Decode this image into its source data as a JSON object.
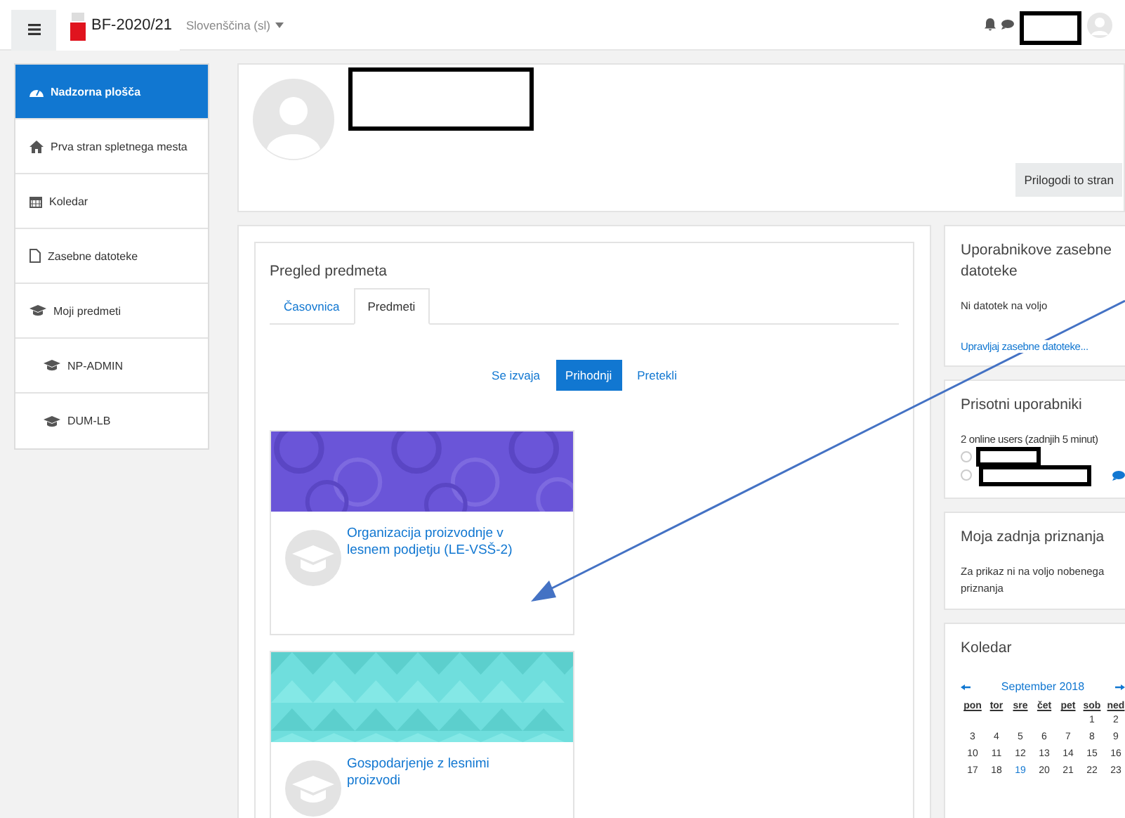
{
  "navbar": {
    "site_name": "BF-2020/21",
    "language": "Slovenščina (sl)"
  },
  "sidebar": {
    "items": [
      {
        "label": "Nadzorna plošča",
        "kind": "dashboard",
        "selected": true
      },
      {
        "label": "Prva stran spletnega mesta",
        "kind": "home",
        "selected": false
      },
      {
        "label": "Koledar",
        "kind": "calendar",
        "selected": false
      },
      {
        "label": "Zasebne datoteke",
        "kind": "file",
        "selected": false
      },
      {
        "label": "Moji predmeti",
        "kind": "course",
        "selected": false,
        "children": [
          {
            "label": "NP-ADMIN",
            "kind": "course",
            "selected": false
          },
          {
            "label": "DUM-LB",
            "kind": "course",
            "selected": false
          }
        ]
      }
    ]
  },
  "header": {
    "button": "Prilogodi to stran"
  },
  "course_overview": {
    "title": "Pregled predmeta",
    "tabs": [
      {
        "label": "Časovnica",
        "selected": false
      },
      {
        "label": "Predmeti",
        "selected": true
      }
    ],
    "filters": [
      {
        "label": "Se izvaja",
        "selected": false
      },
      {
        "label": "Prihodnji",
        "selected": true
      },
      {
        "label": "Pretekli",
        "selected": false
      }
    ],
    "courses": [
      {
        "name": "Organizacija proizvodnje v lesnem podjetju (LE-VSŠ-2)"
      },
      {
        "name": "Gospodarjenje z lesnimi proizvodi"
      }
    ]
  },
  "private_files": {
    "title": "Uporabnikove zasebne datoteke",
    "message": "Ni datotek na voljo",
    "link": "Upravljaj zasebne datoteke..."
  },
  "online_users": {
    "title": "Prisotni uporabniki",
    "summary": "2 online users (zadnjih 5 minut)",
    "users": [
      {
        "message_icon": false
      },
      {
        "message_icon": true
      }
    ]
  },
  "badges": {
    "title": "Moja zadnja priznanja",
    "message": "Za prikaz ni na voljo nobenega priznanja"
  },
  "calendar": {
    "title": "Koledar",
    "month": "September 2018",
    "weekdays": [
      "pon",
      "tor",
      "sre",
      "čet",
      "pet",
      "sob",
      "ned"
    ],
    "weeks": [
      {
        "days": [
          {
            "day": "1",
            "today": false
          },
          {
            "day": "2",
            "today": false
          }
        ]
      },
      {
        "days": [
          {
            "day": "3",
            "today": false
          },
          {
            "day": "4",
            "today": false
          },
          {
            "day": "5",
            "today": false
          },
          {
            "day": "6",
            "today": false
          },
          {
            "day": "7",
            "today": false
          },
          {
            "day": "8",
            "today": false
          },
          {
            "day": "9",
            "today": false
          }
        ]
      },
      {
        "days": [
          {
            "day": "10",
            "today": false
          },
          {
            "day": "11",
            "today": false
          },
          {
            "day": "12",
            "today": false
          },
          {
            "day": "13",
            "today": false
          },
          {
            "day": "14",
            "today": false
          },
          {
            "day": "15",
            "today": false
          },
          {
            "day": "16",
            "today": false
          }
        ]
      },
      {
        "days": [
          {
            "day": "17",
            "today": false
          },
          {
            "day": "18",
            "today": false
          },
          {
            "day": "19",
            "today": true
          },
          {
            "day": "20",
            "today": false
          },
          {
            "day": "21",
            "today": false
          },
          {
            "day": "22",
            "today": false
          },
          {
            "day": "23",
            "today": false
          }
        ]
      }
    ]
  }
}
